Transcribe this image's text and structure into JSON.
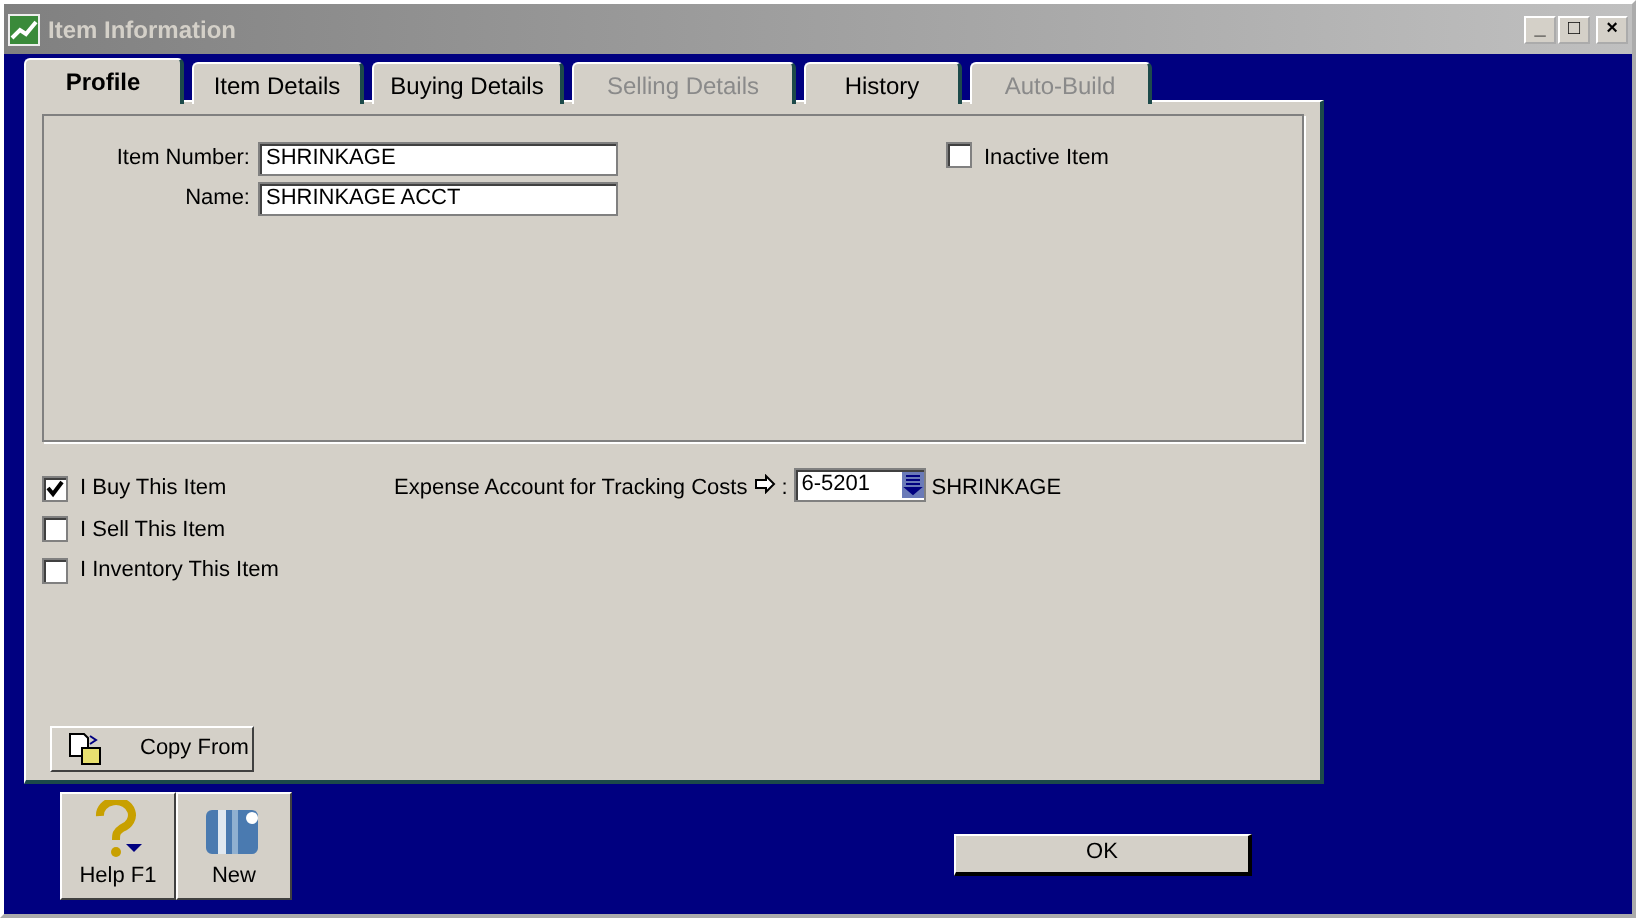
{
  "window": {
    "title": "Item Information",
    "controls": [
      "_",
      "□",
      "×"
    ]
  },
  "tabs": [
    {
      "label": "Profile",
      "selected": true,
      "disabled": false
    },
    {
      "label": "Item Details",
      "selected": false,
      "disabled": false
    },
    {
      "label": "Buying Details",
      "selected": false,
      "disabled": false
    },
    {
      "label": "Selling Details",
      "selected": false,
      "disabled": true
    },
    {
      "label": "History",
      "selected": false,
      "disabled": false
    },
    {
      "label": "Auto-Build",
      "selected": false,
      "disabled": true
    }
  ],
  "fields": [
    {
      "label": "Item Number:",
      "value": "SHRINKAGE"
    },
    {
      "label": "Name:",
      "value": "SHRINKAGE ACCT"
    }
  ],
  "inactive_item": {
    "label": "Inactive Item",
    "checked": false
  },
  "options": [
    {
      "label": "I Buy This Item",
      "checked": true
    },
    {
      "label": "I Sell This Item",
      "checked": false
    },
    {
      "label": "I Inventory This Item",
      "checked": false
    }
  ],
  "expense_account": {
    "label": "Expense Account for Tracking Costs",
    "colon": ":",
    "value": "6-5201",
    "account_name": "SHRINKAGE"
  },
  "copy_from": "Copy From",
  "toolbar": [
    {
      "kind": "help",
      "label": "Help F1"
    },
    {
      "kind": "new",
      "label": "New"
    }
  ],
  "ok": "OK"
}
